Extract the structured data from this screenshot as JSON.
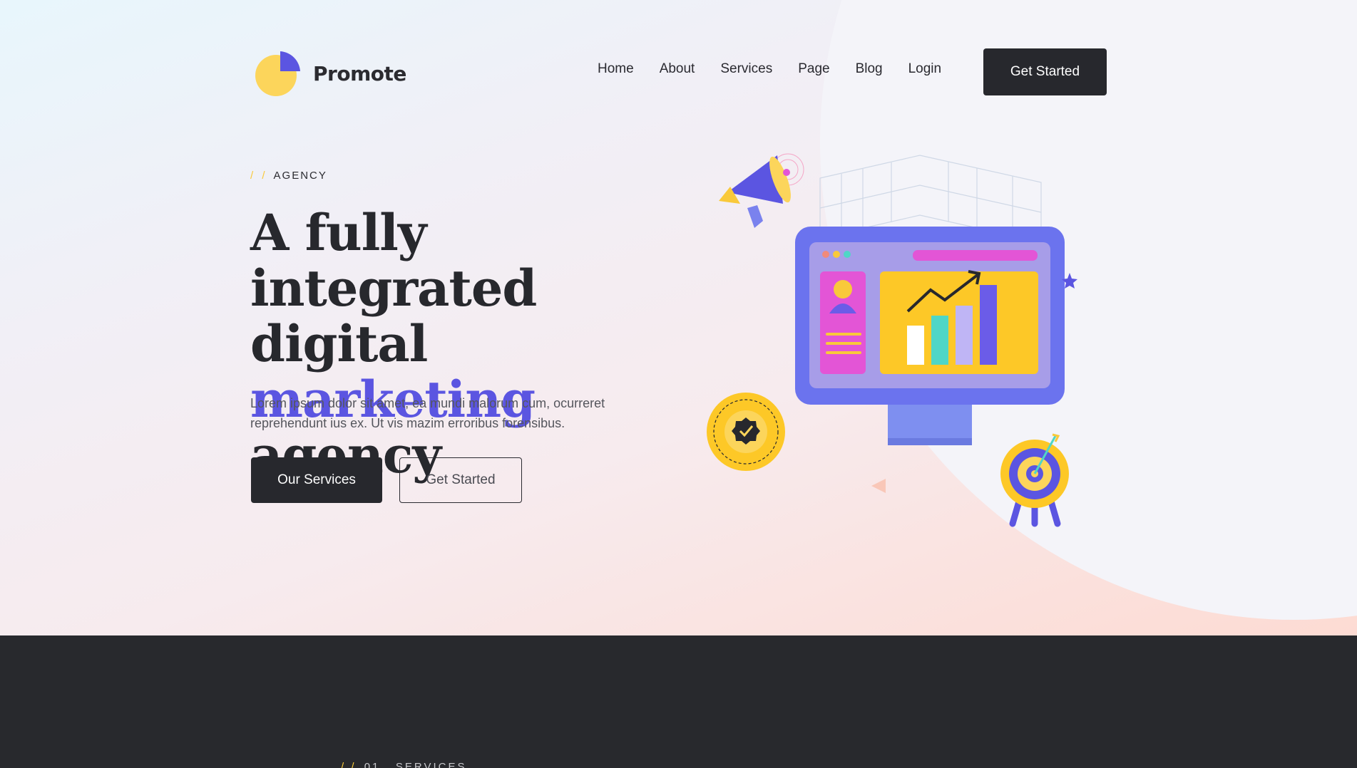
{
  "brand": {
    "name": "Promote"
  },
  "nav": {
    "items": [
      "Home",
      "About",
      "Services",
      "Page",
      "Blog",
      "Login"
    ],
    "cta_label": "Get Started"
  },
  "hero": {
    "eyebrow_slashes": "/ /",
    "eyebrow": "AGENCY",
    "headline_part1": "A fully integrated digital",
    "headline_accent": "marketing",
    "headline_part2": "agency",
    "lede": "Lorem ipsum dolor sit amet, ea mundi malorum cum, ocurreret reprehendunt ius ex. Ut vis mazim erroribus forensibus.",
    "primary_button": "Our Services",
    "secondary_button": "Get Started"
  },
  "services": {
    "eyebrow_slashes": "/ /",
    "eyebrow": "01 . SERVICES"
  },
  "colors": {
    "accent": "#5b55e1",
    "dark": "#27282d",
    "yellow": "#f9c93a",
    "pink": "#e355d6",
    "teal": "#4fd6c6"
  },
  "icons": {
    "logo": "pie-chart-icon",
    "megaphone": "megaphone-icon",
    "badge": "verified-badge-icon",
    "target": "target-icon",
    "monitor": "monitor-chart-icon"
  }
}
